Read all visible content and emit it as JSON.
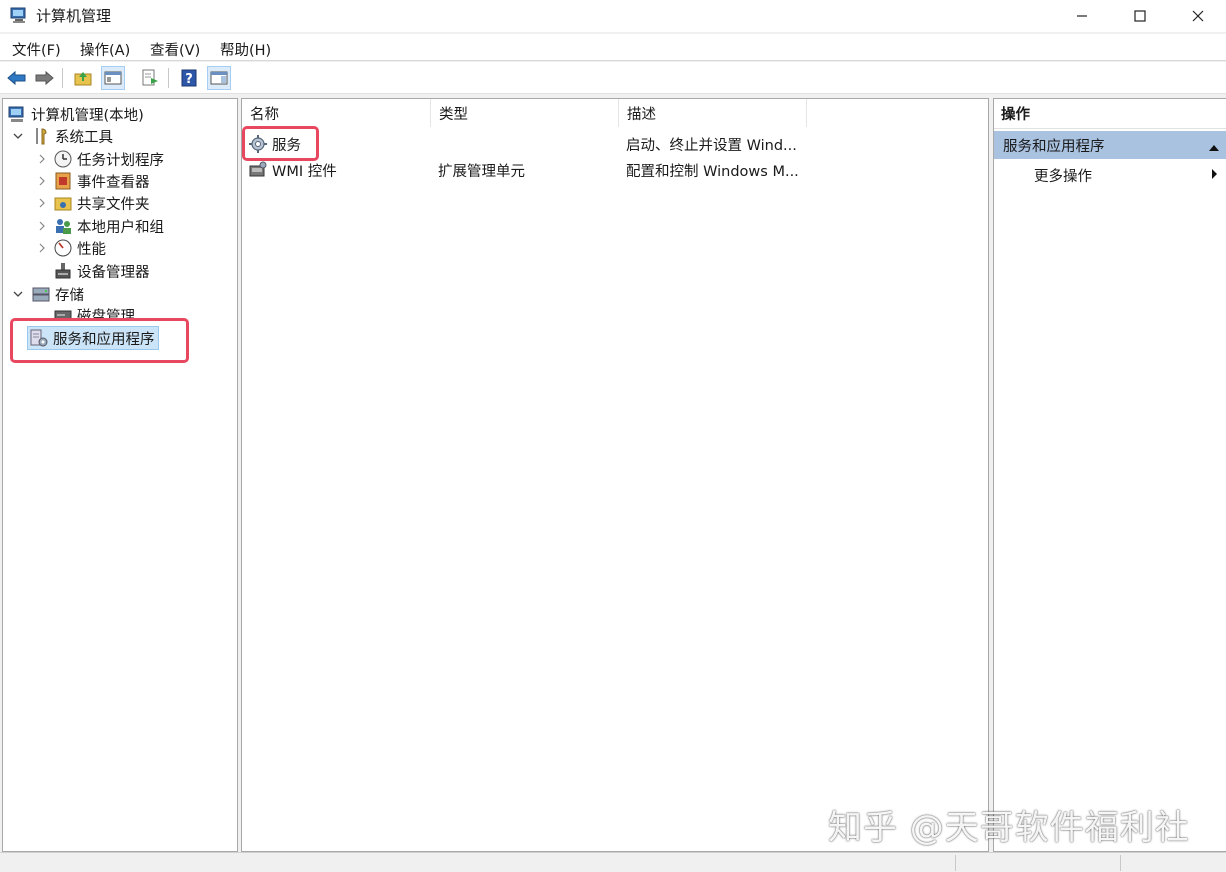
{
  "window": {
    "title": "计算机管理"
  },
  "menu": [
    "文件(F)",
    "操作(A)",
    "查看(V)",
    "帮助(H)"
  ],
  "tree": {
    "root": "计算机管理(本地)",
    "system_tools": "系统工具",
    "system_tools_children": [
      "任务计划程序",
      "事件查看器",
      "共享文件夹",
      "本地用户和组",
      "性能",
      "设备管理器"
    ],
    "storage": "存储",
    "disk_management": "磁盘管理",
    "services_apps": "服务和应用程序"
  },
  "list": {
    "columns": [
      "名称",
      "类型",
      "描述"
    ],
    "rows": [
      {
        "name": "服务",
        "type": "",
        "desc": "启动、终止并设置 Wind..."
      },
      {
        "name": "WMI 控件",
        "type": "扩展管理单元",
        "desc": "配置和控制 Windows M..."
      }
    ]
  },
  "actions": {
    "header": "操作",
    "group": "服务和应用程序",
    "more": "更多操作"
  },
  "watermark": "知乎 @天哥软件福利社",
  "colors": {
    "highlight": "#e8485f",
    "selection": "#cce4f7",
    "action_group": "#a9c2e0"
  }
}
